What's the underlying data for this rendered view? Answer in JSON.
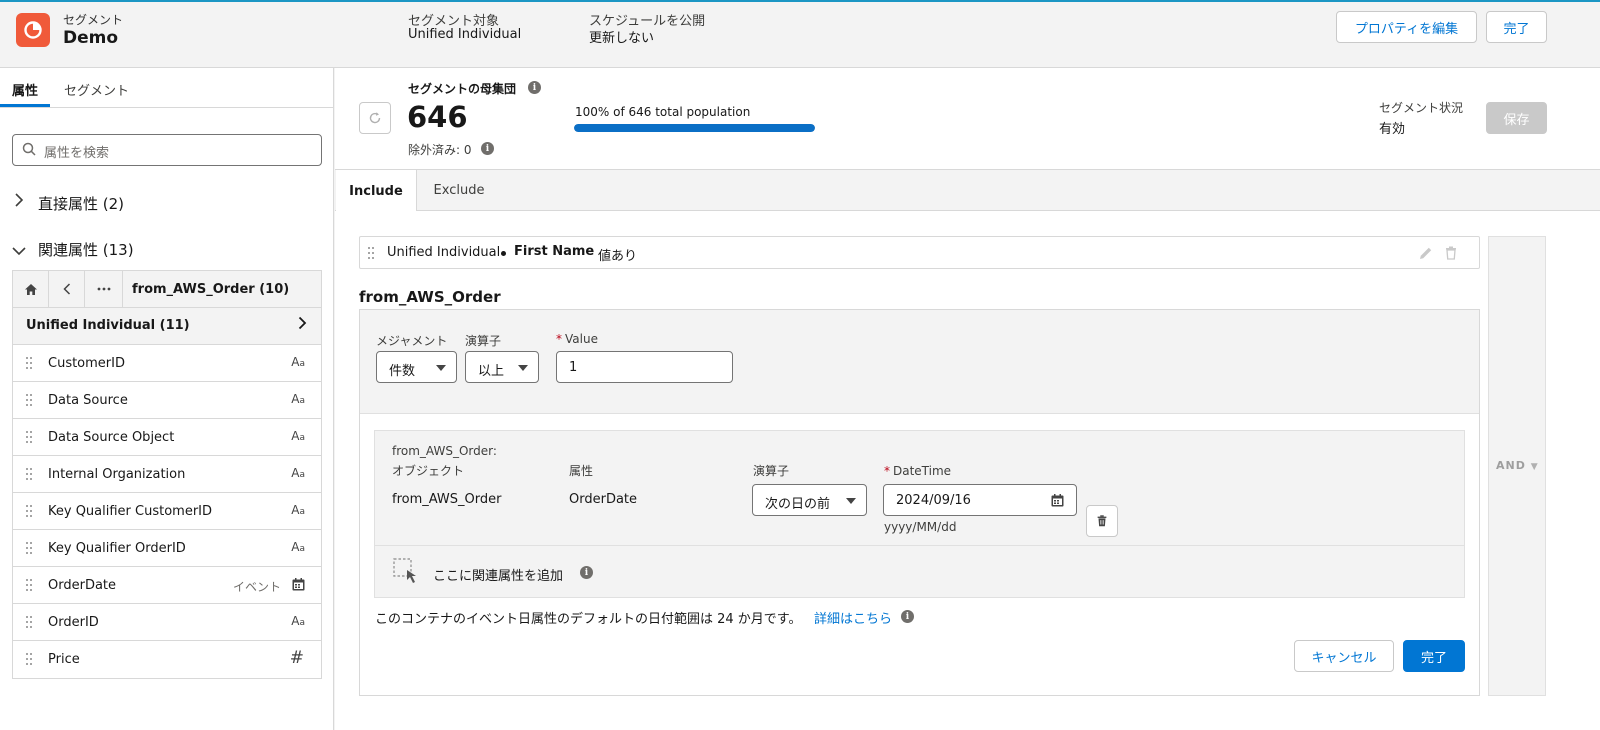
{
  "header": {
    "subtitle": "セグメント",
    "title": "Demo",
    "target_label": "セグメント対象",
    "target_value": "Unified Individual",
    "schedule_label": "スケジュールを公開",
    "schedule_value": "更新しない",
    "edit_properties_label": "プロパティを編集",
    "done_label": "完了"
  },
  "left_panel": {
    "tabs": [
      "属性",
      "セグメント"
    ],
    "search_placeholder": "属性を検索",
    "direct_attributes": "直接属性 (2)",
    "related_attributes": "関連属性 (13)",
    "nav_title": "from_AWS_Order (10)",
    "list_header": "Unified Individual (11)",
    "items": [
      {
        "label": "CustomerID",
        "type": "Aa"
      },
      {
        "label": "Data Source",
        "type": "Aa"
      },
      {
        "label": "Data Source Object",
        "type": "Aa"
      },
      {
        "label": "Internal Organization",
        "type": "Aa"
      },
      {
        "label": "Key Qualifier CustomerID",
        "type": "Aa"
      },
      {
        "label": "Key Qualifier OrderID",
        "type": "Aa"
      },
      {
        "label": "OrderDate",
        "type": "calendar",
        "tag": "イベント"
      },
      {
        "label": "OrderID",
        "type": "Aa"
      },
      {
        "label": "Price",
        "type": "#"
      }
    ]
  },
  "population": {
    "label": "セグメントの母集団",
    "count": "646",
    "excluded": "除外済み: 0",
    "percent_text": "100% of 646 total population",
    "percent": 100,
    "status_label": "セグメント状況",
    "status_value": "有効",
    "save_label": "保存"
  },
  "tabs": {
    "include": "Include",
    "exclude": "Exclude"
  },
  "condition": {
    "object": "Unified Individual",
    "attribute": "First Name",
    "operator": "値あり"
  },
  "related": {
    "title": "from_AWS_Order",
    "measure_label": "メジャメント",
    "measure_value": "件数",
    "operator_label": "演算子",
    "operator_value": "以上",
    "value_label": "Value",
    "value": "1",
    "sub_header": "from_AWS_Order:",
    "object_label": "オブジェクト",
    "object_value": "from_AWS_Order",
    "attribute_label": "属性",
    "attribute_value": "OrderDate",
    "sub_operator_label": "演算子",
    "sub_operator_value": "次の日の前",
    "datetime_label": "DateTime",
    "datetime_value": "2024/09/16",
    "date_format": "yyyy/MM/dd",
    "add_related": "ここに関連属性を追加",
    "footnote": "このコンテナのイベント日属性のデフォルトの日付範囲は 24 か月です。",
    "learn_more": "詳細はこちら",
    "cancel_label": "キャンセル",
    "done_label": "完了"
  },
  "logic": {
    "and_label": "AND"
  },
  "colors": {
    "brand": "#0176d3",
    "logo": "#f05a3a",
    "progress": "#0b6fc6"
  }
}
